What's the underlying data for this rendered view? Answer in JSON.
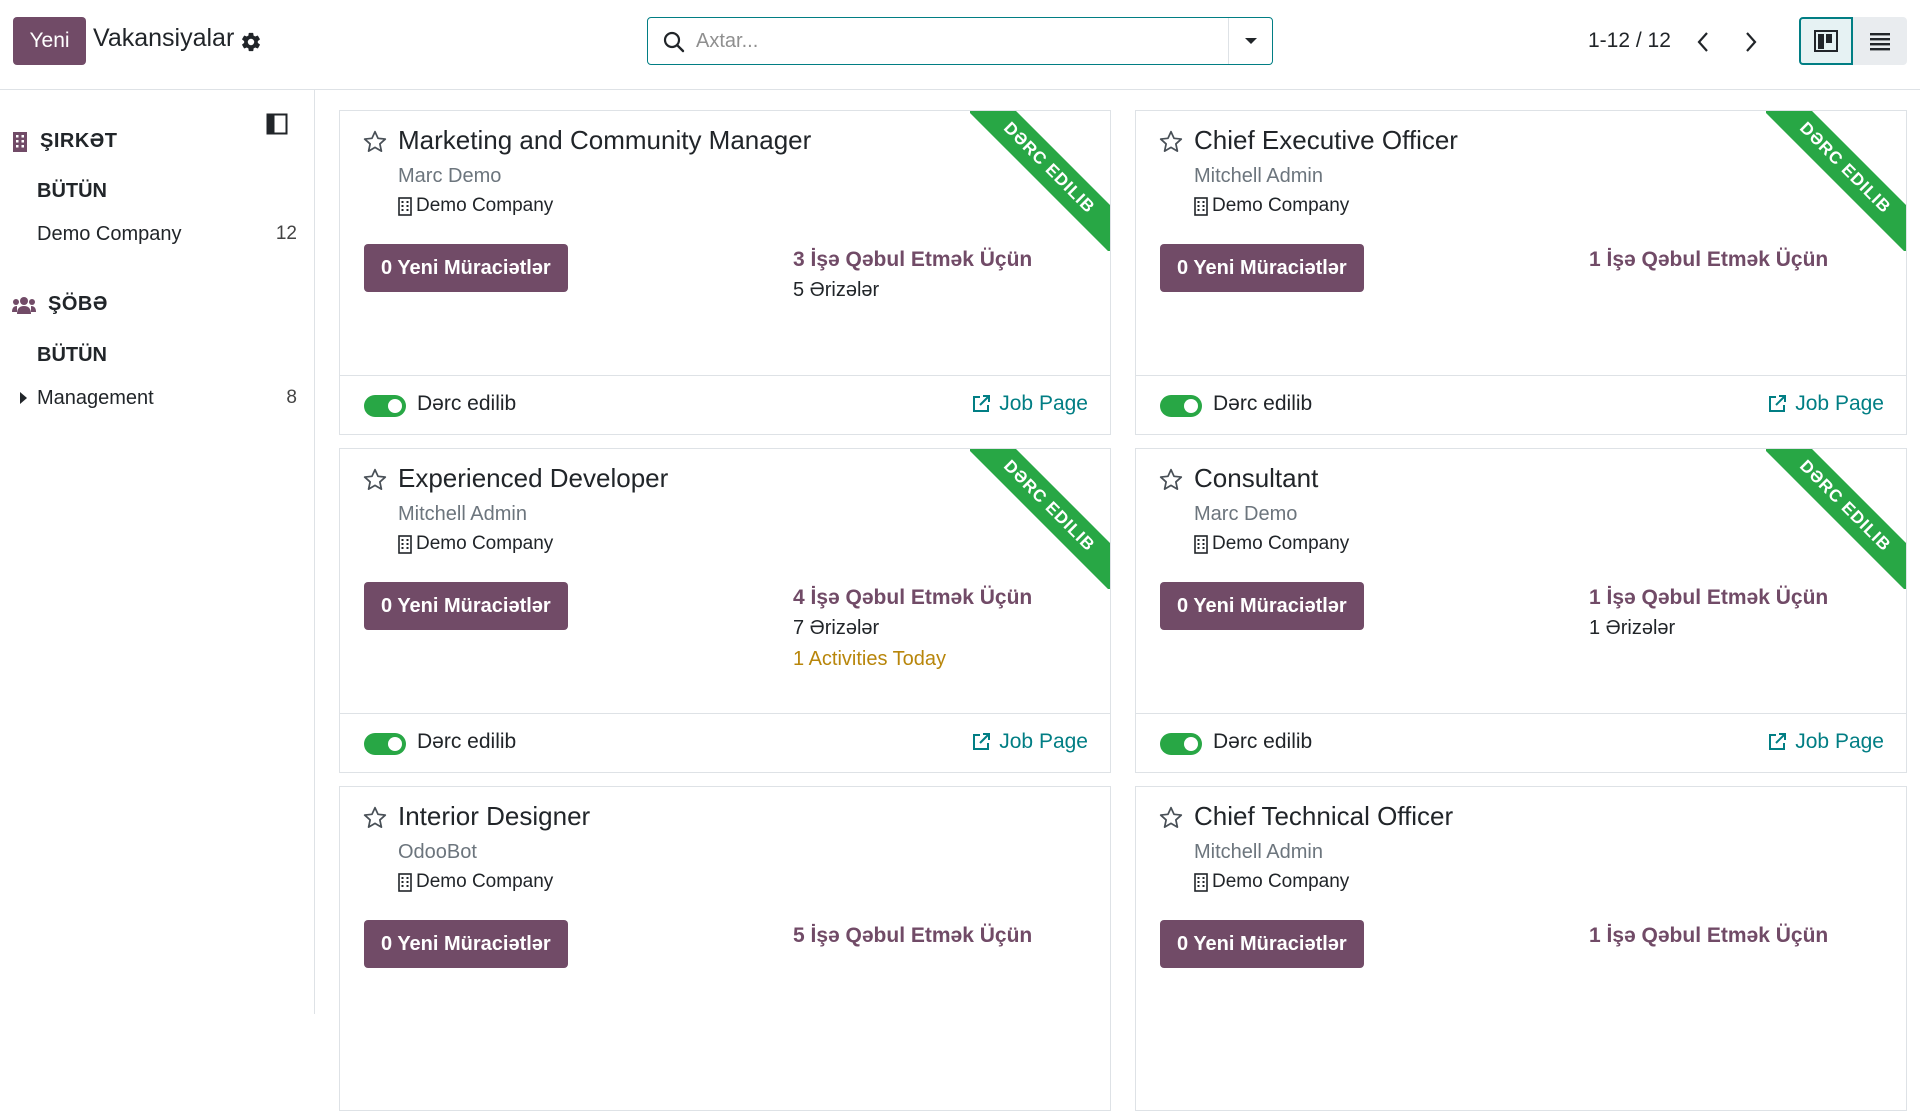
{
  "topbar": {
    "new_label": "Yeni",
    "title": "Vakansiyalar",
    "search_placeholder": "Axtar...",
    "pager": "1-12 / 12"
  },
  "colors": {
    "brand": "#714b67",
    "accent": "#017e84",
    "published": "#28a745",
    "activity": "#b8860b"
  },
  "sidebar": {
    "company_heading": "ŞIRKƏT",
    "company_all": "BÜTÜN",
    "company_item": {
      "label": "Demo Company",
      "count": "12"
    },
    "department_heading": "ŞÖBƏ",
    "department_all": "BÜTÜN",
    "department_item": {
      "label": "Management",
      "count": "8"
    }
  },
  "cards": [
    {
      "title": "Marketing and Community Manager",
      "owner": "Marc Demo",
      "company": "Demo Company",
      "apps_btn": "0 Yeni Müraciətlər",
      "to_recruit": "3 İşə Qəbul Etmək Üçün",
      "applications": "5 Ərizələr",
      "activities": "",
      "published_label": "Dərc edilib",
      "job_page": "Job Page",
      "ribbon": "DƏRC EDILIB"
    },
    {
      "title": "Chief Executive Officer",
      "owner": "Mitchell Admin",
      "company": "Demo Company",
      "apps_btn": "0 Yeni Müraciətlər",
      "to_recruit": "1 İşə Qəbul Etmək Üçün",
      "applications": "",
      "activities": "",
      "published_label": "Dərc edilib",
      "job_page": "Job Page",
      "ribbon": "DƏRC EDILIB"
    },
    {
      "title": "Experienced Developer",
      "owner": "Mitchell Admin",
      "company": "Demo Company",
      "apps_btn": "0 Yeni Müraciətlər",
      "to_recruit": "4 İşə Qəbul Etmək Üçün",
      "applications": "7 Ərizələr",
      "activities": "1 Activities Today",
      "published_label": "Dərc edilib",
      "job_page": "Job Page",
      "ribbon": "DƏRC EDILIB"
    },
    {
      "title": "Consultant",
      "owner": "Marc Demo",
      "company": "Demo Company",
      "apps_btn": "0 Yeni Müraciətlər",
      "to_recruit": "1 İşə Qəbul Etmək Üçün",
      "applications": "1 Ərizələr",
      "activities": "",
      "published_label": "Dərc edilib",
      "job_page": "Job Page",
      "ribbon": "DƏRC EDILIB"
    },
    {
      "title": "Interior Designer",
      "owner": "OdooBot",
      "company": "Demo Company",
      "apps_btn": "0 Yeni Müraciətlər",
      "to_recruit": "5 İşə Qəbul Etmək Üçün",
      "applications": "",
      "activities": "",
      "published_label": "",
      "job_page": "",
      "ribbon": ""
    },
    {
      "title": "Chief Technical Officer",
      "owner": "Mitchell Admin",
      "company": "Demo Company",
      "apps_btn": "0 Yeni Müraciətlər",
      "to_recruit": "1 İşə Qəbul Etmək Üçün",
      "applications": "",
      "activities": "",
      "published_label": "",
      "job_page": "",
      "ribbon": ""
    }
  ]
}
